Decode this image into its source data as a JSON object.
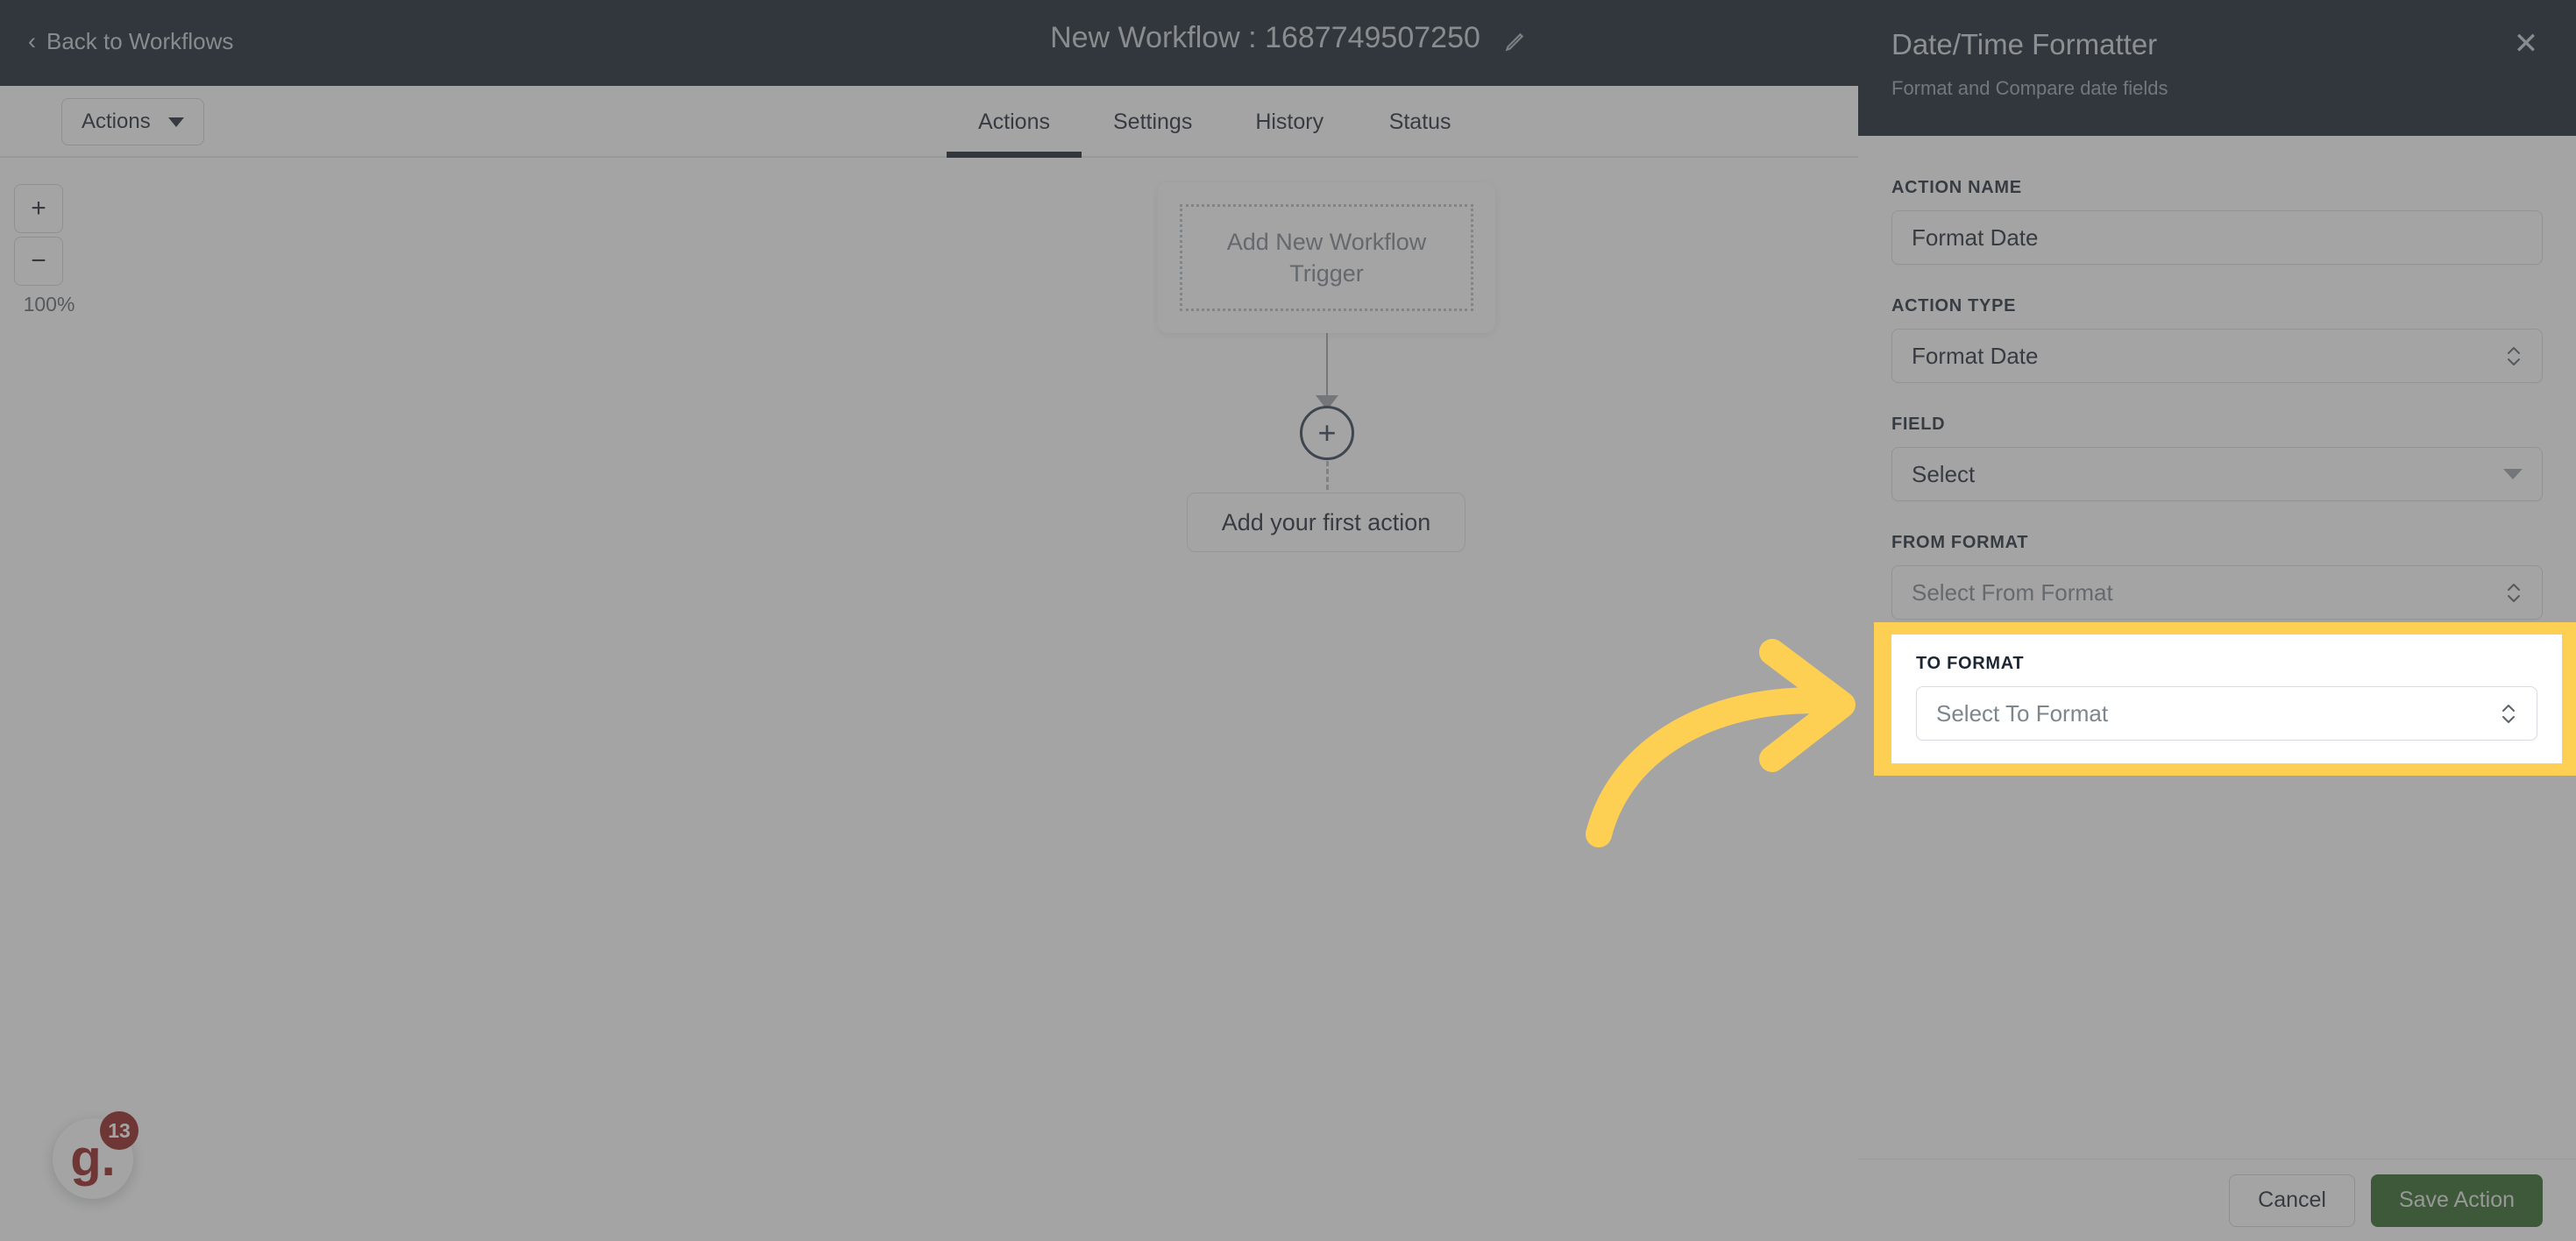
{
  "header": {
    "back_label": "Back to Workflows",
    "back_icon": "chevron-left-icon",
    "workflow_title": "New Workflow : 1687749507250",
    "edit_icon": "pencil-icon"
  },
  "subbar": {
    "actions_menu_label": "Actions",
    "actions_menu_icon": "chevron-down-icon",
    "tabs": [
      {
        "label": "Actions",
        "active": true
      },
      {
        "label": "Settings",
        "active": false
      },
      {
        "label": "History",
        "active": false
      },
      {
        "label": "Status",
        "active": false
      }
    ]
  },
  "canvas": {
    "zoom": {
      "zoom_in_label": "+",
      "zoom_out_label": "−",
      "level": "100%"
    },
    "trigger_card_label": "Add New Workflow Trigger",
    "add_node_label": "+",
    "first_action_label": "Add your first action",
    "chat_widget": {
      "logo_text": "g.",
      "badge_count": "13"
    }
  },
  "panel": {
    "title": "Date/Time Formatter",
    "subtitle": "Format and Compare date fields",
    "close_icon": "close-icon",
    "fields": [
      {
        "label": "ACTION NAME",
        "value": "Format Date",
        "placeholder": "",
        "control": "text-input",
        "highlighted": false
      },
      {
        "label": "ACTION TYPE",
        "value": "Format Date",
        "placeholder": "",
        "control": "stepper-select",
        "highlighted": false
      },
      {
        "label": "FIELD",
        "value": "Select",
        "placeholder": "Select",
        "control": "dropdown",
        "highlighted": false
      },
      {
        "label": "FROM FORMAT",
        "value": "",
        "placeholder": "Select From Format",
        "control": "stepper-select",
        "highlighted": false
      },
      {
        "label": "TO FORMAT",
        "value": "",
        "placeholder": "Select To Format",
        "control": "stepper-select",
        "highlighted": true
      }
    ],
    "footer": {
      "cancel_label": "Cancel",
      "save_label": "Save Action"
    }
  },
  "annotation": {
    "arrow_icon": "curved-arrow-right-icon",
    "arrow_color": "#fdcf52",
    "highlight_color": "#fdcf52"
  },
  "colors": {
    "header_dark": "#101c26",
    "accent_yellow": "#fdcf52",
    "save_green": "#2b6122",
    "badge_red": "#8f1a17",
    "dim": "rgba(80,80,80,0.52)"
  }
}
